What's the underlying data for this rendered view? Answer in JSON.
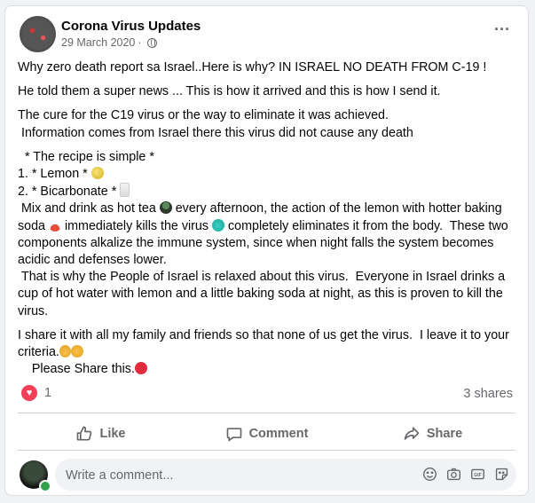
{
  "post": {
    "page_name": "Corona Virus Updates",
    "date": "29 March 2020",
    "separator": "·",
    "paragraphs": [
      "Why zero death report sa Israel..Here is why? IN ISRAEL NO DEATH FROM C-19 !",
      "He told them a super news ... This is how it arrived and this is how I send it.",
      "The cure for the C19 virus or the way to eliminate it was achieved.\n Information comes from Israel there this virus did not cause any death"
    ],
    "recipe": {
      "intro": "  * The recipe is simple *",
      "item1": "1. * Lemon * ",
      "item2": "2. * Bicarbonate * ",
      "line_a1": " Mix and drink as hot tea ",
      "line_a2": " every afternoon, the action of the lemon with hotter baking soda ",
      "line_a3": " immediately kills the virus ",
      "line_a4": " completely eliminates it from the body.  These two components alkalize the immune system, since when night falls the system becomes acidic and defenses lower.",
      "line_b": " That is why the People of Israel is relaxed about this virus.  Everyone in Israel drinks a cup of hot water with lemon and a little baking soda at night, as this is proven to kill the virus."
    },
    "closing_1": "I share it with all my family and friends so that none of us get the virus.  I leave it to your criteria.",
    "closing_2": "    Please Share this."
  },
  "stats": {
    "reaction_count": "1",
    "shares": "3 shares"
  },
  "actions": {
    "like": "Like",
    "comment": "Comment",
    "share": "Share"
  },
  "comment_box": {
    "placeholder": "Write a comment..."
  },
  "colors": {
    "heart": "#f33e58",
    "muted": "#65676b",
    "online": "#31a24c"
  }
}
